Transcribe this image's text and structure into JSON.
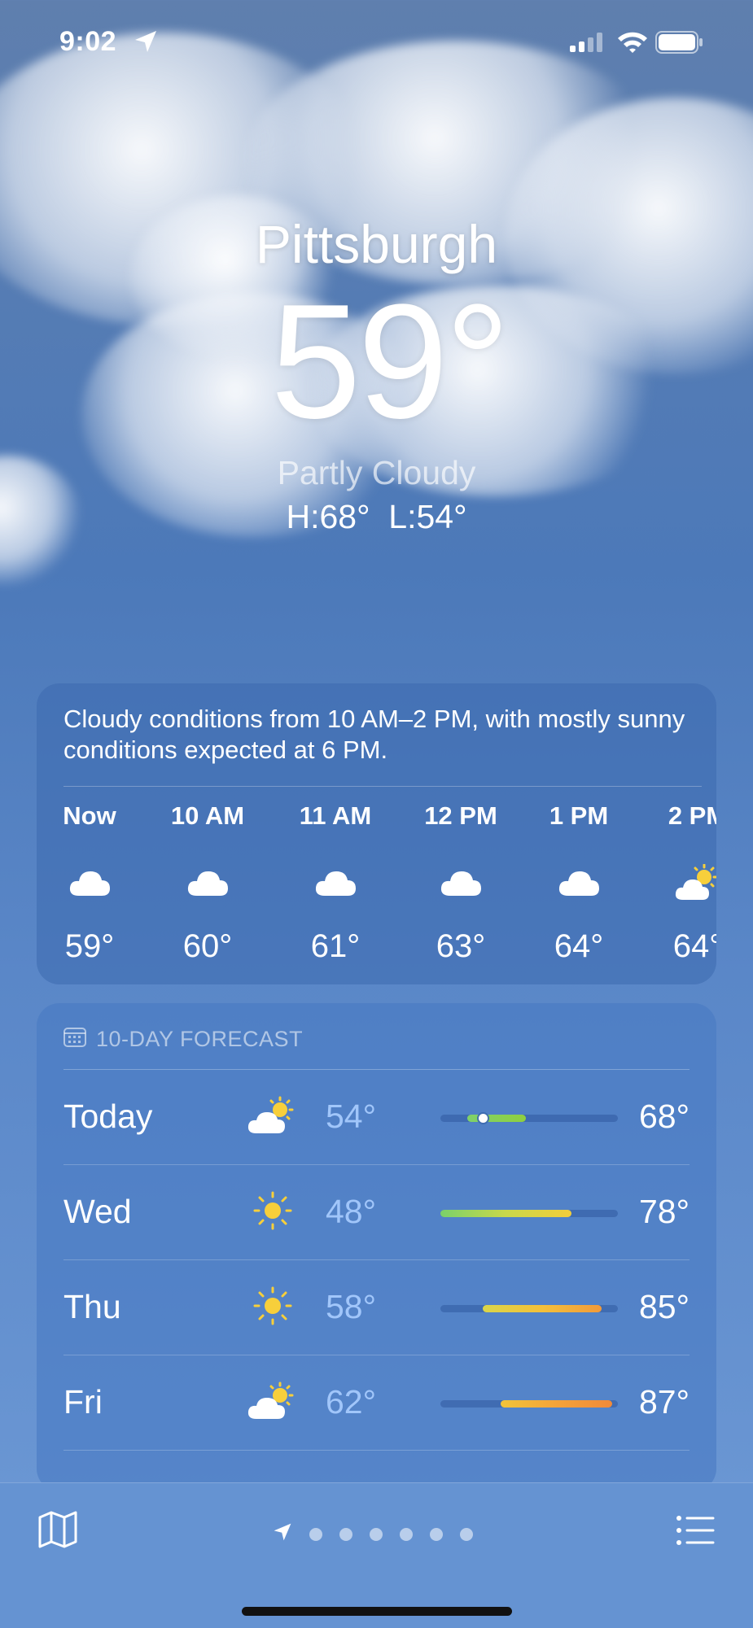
{
  "status_bar": {
    "time": "9:02",
    "icons": [
      "location-arrow-icon",
      "cellular-signal-icon",
      "wifi-icon",
      "battery-icon"
    ]
  },
  "current": {
    "city": "Pittsburgh",
    "temperature": "59°",
    "condition": "Partly Cloudy",
    "hi_lo": "H:68°  L:54°"
  },
  "hourly": {
    "summary": "Cloudy conditions from 10 AM–2 PM, with mostly sunny conditions expected at 6 PM.",
    "hours": [
      {
        "label": "Now",
        "icon": "cloud-icon",
        "temp": "59°"
      },
      {
        "label": "10 AM",
        "icon": "cloud-icon",
        "temp": "60°"
      },
      {
        "label": "11 AM",
        "icon": "cloud-icon",
        "temp": "61°"
      },
      {
        "label": "12 PM",
        "icon": "cloud-icon",
        "temp": "63°"
      },
      {
        "label": "1 PM",
        "icon": "cloud-icon",
        "temp": "64°"
      },
      {
        "label": "2 PM",
        "icon": "partly-sunny-icon",
        "temp": "64°"
      }
    ]
  },
  "forecast": {
    "header": "10-DAY FORECAST",
    "days": [
      {
        "day": "Today",
        "icon": "partly-sunny-icon",
        "low": "54°",
        "high": "68°",
        "range_start": 0.15,
        "range_end": 0.48,
        "current_marker": 0.24,
        "gradient": "linear-gradient(90deg,#7fd16a,#8fcf3f)"
      },
      {
        "day": "Wed",
        "icon": "sun-icon",
        "low": "48°",
        "high": "78°",
        "range_start": 0.0,
        "range_end": 0.74,
        "gradient": "linear-gradient(90deg,#7ad16a,#c9d84a,#f3cd3a)"
      },
      {
        "day": "Thu",
        "icon": "sun-icon",
        "low": "58°",
        "high": "85°",
        "range_start": 0.24,
        "range_end": 0.91,
        "gradient": "linear-gradient(90deg,#d9d64a,#f3c03a,#f29a3a)"
      },
      {
        "day": "Fri",
        "icon": "partly-sunny-icon",
        "low": "62°",
        "high": "87°",
        "range_start": 0.34,
        "range_end": 0.97,
        "gradient": "linear-gradient(90deg,#f2c43a,#f4a33a,#f08a3a)"
      }
    ]
  },
  "bottom_bar": {
    "icons": [
      "map-icon",
      "location-arrow-icon",
      "list-icon"
    ],
    "page_dots": 6,
    "active_page": "location"
  }
}
